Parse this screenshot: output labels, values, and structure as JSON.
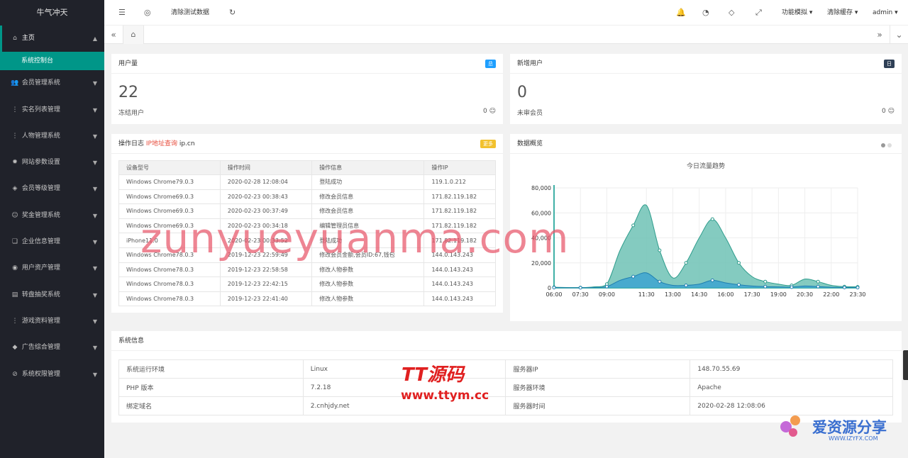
{
  "sidebar": {
    "brand": "牛气冲天",
    "items": [
      {
        "label": "主页",
        "icon": "⌂",
        "active": true
      },
      {
        "label": "会员管理系统",
        "icon": "👥"
      },
      {
        "label": "实名列表管理",
        "icon": "⋮"
      },
      {
        "label": "人物管理系统",
        "icon": "⋮"
      },
      {
        "label": "网站参数设置",
        "icon": "✹"
      },
      {
        "label": "会员等级管理",
        "icon": "◈"
      },
      {
        "label": "奖金管理系统",
        "icon": "☺"
      },
      {
        "label": "企业信息管理",
        "icon": "❏"
      },
      {
        "label": "用户资产管理",
        "icon": "◉"
      },
      {
        "label": "转盘抽奖系统",
        "icon": "▤"
      },
      {
        "label": "游戏资料管理",
        "icon": "⋮"
      },
      {
        "label": "广告综合管理",
        "icon": "◆"
      },
      {
        "label": "系统权限管理",
        "icon": "⊘"
      }
    ],
    "sub_active": "系统控制台"
  },
  "header": {
    "clear_test": "清除测试数据",
    "func_sim": "功能模拟",
    "clear_cache": "清除缓存",
    "user": "admin"
  },
  "cards": {
    "users": {
      "title": "用户量",
      "value": "22",
      "foot_left": "冻结用户",
      "foot_right": "0",
      "badge": "总",
      "badge_color": "#1e9fff"
    },
    "new_users": {
      "title": "新增用户",
      "value": "0",
      "foot_left": "未审会员",
      "foot_right": "0",
      "badge": "日",
      "badge_color": "#2f4056"
    }
  },
  "log": {
    "title": "操作日志",
    "link": "IP地址查询",
    "link_suffix": "ip.cn",
    "badge": "更多",
    "columns": [
      "设备型号",
      "操作时间",
      "操作信息",
      "操作IP"
    ],
    "rows": [
      [
        "Windows Chrome79.0.3",
        "2020-02-28 12:08:04",
        "登陆成功",
        "119.1.0.212"
      ],
      [
        "Windows Chrome69.0.3",
        "2020-02-23 00:38:43",
        "修改会员信息",
        "171.82.119.182"
      ],
      [
        "Windows Chrome69.0.3",
        "2020-02-23 00:37:49",
        "修改会员信息",
        "171.82.119.182"
      ],
      [
        "Windows Chrome69.0.3",
        "2020-02-23 00:34:18",
        "编辑管理员信息",
        "171.82.119.182"
      ],
      [
        "iPhone11.0",
        "2020-02-23 00:33:52",
        "登陆成功",
        "171.82.119.182"
      ],
      [
        "Windows Chrome78.0.3",
        "2019-12-23 22:59:49",
        "修改会员金额,会员ID:67,钱包",
        "144.0.143.243"
      ],
      [
        "Windows Chrome78.0.3",
        "2019-12-23 22:58:58",
        "修改人物参数",
        "144.0.143.243"
      ],
      [
        "Windows Chrome78.0.3",
        "2019-12-23 22:42:15",
        "修改人物参数",
        "144.0.143.243"
      ],
      [
        "Windows Chrome78.0.3",
        "2019-12-23 22:41:40",
        "修改人物参数",
        "144.0.143.243"
      ]
    ]
  },
  "overview": {
    "title": "数据概览",
    "chart_title": "今日流量趋势"
  },
  "chart_data": {
    "type": "area",
    "title": "今日流量趋势",
    "x": [
      "06:00",
      "06:45",
      "07:30",
      "08:15",
      "09:00",
      "09:45",
      "10:30",
      "11:30",
      "12:15",
      "13:00",
      "13:45",
      "14:30",
      "15:15",
      "16:00",
      "16:45",
      "17:30",
      "18:15",
      "19:00",
      "19:45",
      "20:30",
      "21:15",
      "22:00",
      "22:45",
      "23:30"
    ],
    "x_tick_labels": [
      "06:00",
      "07:30",
      "09:00",
      "11:30",
      "13:00",
      "14:30",
      "16:00",
      "17:30",
      "19:00",
      "20:30",
      "22:00",
      "23:30"
    ],
    "series": [
      {
        "values": [
          500,
          300,
          200,
          800,
          3000,
          30000,
          50000,
          66000,
          30000,
          8000,
          20000,
          40000,
          55000,
          40000,
          20000,
          9000,
          5000,
          3000,
          2000,
          7000,
          5000,
          2000,
          1000,
          800
        ],
        "color": "#6fc2b5"
      },
      {
        "values": [
          200,
          100,
          100,
          300,
          1000,
          6000,
          9000,
          12000,
          5000,
          2000,
          2000,
          3000,
          6000,
          4000,
          2500,
          1500,
          1000,
          800,
          600,
          1500,
          1000,
          500,
          300,
          200
        ],
        "color": "#3aa1d1"
      }
    ],
    "ylim": [
      0,
      80000
    ],
    "y_ticks": [
      "0",
      "20,000",
      "40,000",
      "60,000",
      "80,000"
    ],
    "grid": true
  },
  "system": {
    "title": "系统信息",
    "rows": [
      [
        "系统运行环境",
        "Linux",
        "服务器IP",
        "148.70.55.69"
      ],
      [
        "PHP 版本",
        "7.2.18",
        "服务器环境",
        "Apache"
      ],
      [
        "绑定域名",
        "2.cnhjdy.net",
        "服务器时间",
        "2020-02-28 12:08:06"
      ]
    ]
  },
  "watermarks": {
    "main": "zunyueyuanma.com",
    "tt1": "TT源码",
    "tt2": "www.ttym.cc",
    "aiz1": "爱资源分享",
    "aiz2": "WWW.IZYFX.COM"
  }
}
